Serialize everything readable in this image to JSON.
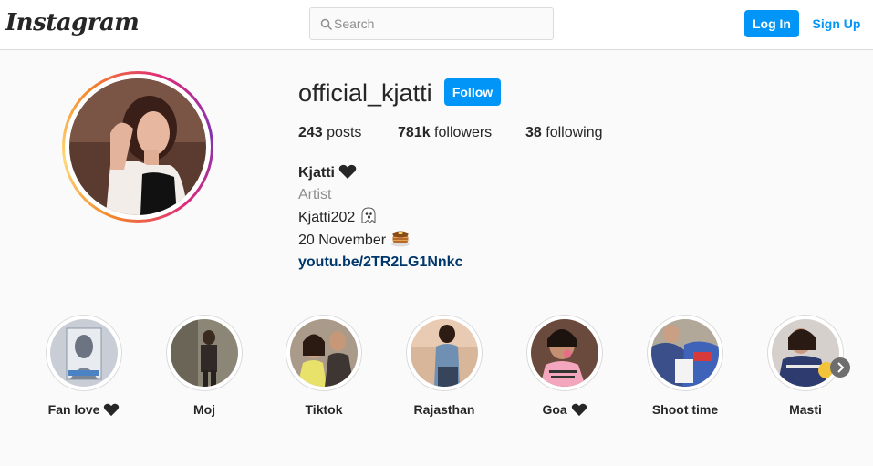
{
  "header": {
    "logo_text": "Instagram",
    "search": {
      "placeholder": "Search",
      "value": "",
      "icon": "search-icon"
    },
    "login_label": "Log In",
    "signup_label": "Sign Up",
    "accent": "#0095f6"
  },
  "profile": {
    "username": "official_kjatti",
    "follow_label": "Follow",
    "stats": {
      "posts_count": "243",
      "posts_label": "posts",
      "followers_count": "781k",
      "followers_label": "followers",
      "following_count": "38",
      "following_label": "following"
    },
    "bio": {
      "name": "Kjatti",
      "category": "Artist",
      "line1": "Kjatti202",
      "line2": "20 November",
      "link": "youtu.be/2TR2LG1Nnkc"
    }
  },
  "highlights": [
    {
      "label": "Fan love"
    },
    {
      "label": "Moj"
    },
    {
      "label": "Tiktok"
    },
    {
      "label": "Rajasthan"
    },
    {
      "label": "Goa"
    },
    {
      "label": "Shoot time"
    },
    {
      "label": "Masti"
    }
  ]
}
